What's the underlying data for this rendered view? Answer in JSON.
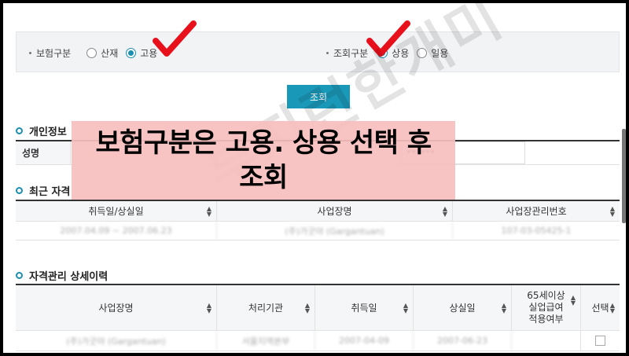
{
  "filters": {
    "insurance_type": {
      "label": "보험구분",
      "options": [
        {
          "label": "산재",
          "selected": false
        },
        {
          "label": "고용",
          "selected": true
        }
      ]
    },
    "query_type": {
      "label": "조회구분",
      "options": [
        {
          "label": "상용",
          "selected": true
        },
        {
          "label": "일용",
          "selected": false
        }
      ]
    }
  },
  "search_button": "조회",
  "personal_info": {
    "title": "개인정보",
    "name_label": "성명",
    "id_value": "******"
  },
  "recent": {
    "title": "최근 자격",
    "headers": [
      "취득일/상실일",
      "사업장명",
      "사업장관리번호"
    ],
    "row": [
      "2007.04.09 ~ 2007.06.23",
      "(주)가굿야 (Gargantuan)",
      "107-03-05425-1"
    ]
  },
  "detail": {
    "title": "자격관리 상세이력",
    "headers": [
      "사업장명",
      "처리기관",
      "취득일",
      "상실일",
      "65세이상 실업급여 적용여부",
      "선택"
    ],
    "header_lines": {
      "elderly": [
        "65세이상",
        "실업급여",
        "적용여부"
      ]
    },
    "row": [
      "(주)가굿야 (Gargantuan)",
      "서울지역본부",
      "2007-04-09",
      "2007-06-23"
    ]
  },
  "overlay": {
    "line1": "보험구분은 고용. 상용 선택 후",
    "line2": "조회"
  },
  "watermark": "부지런한개미",
  "colors": {
    "accent": "#1a98b8",
    "check": "#e8101a",
    "overlay": "#f6bebe"
  }
}
